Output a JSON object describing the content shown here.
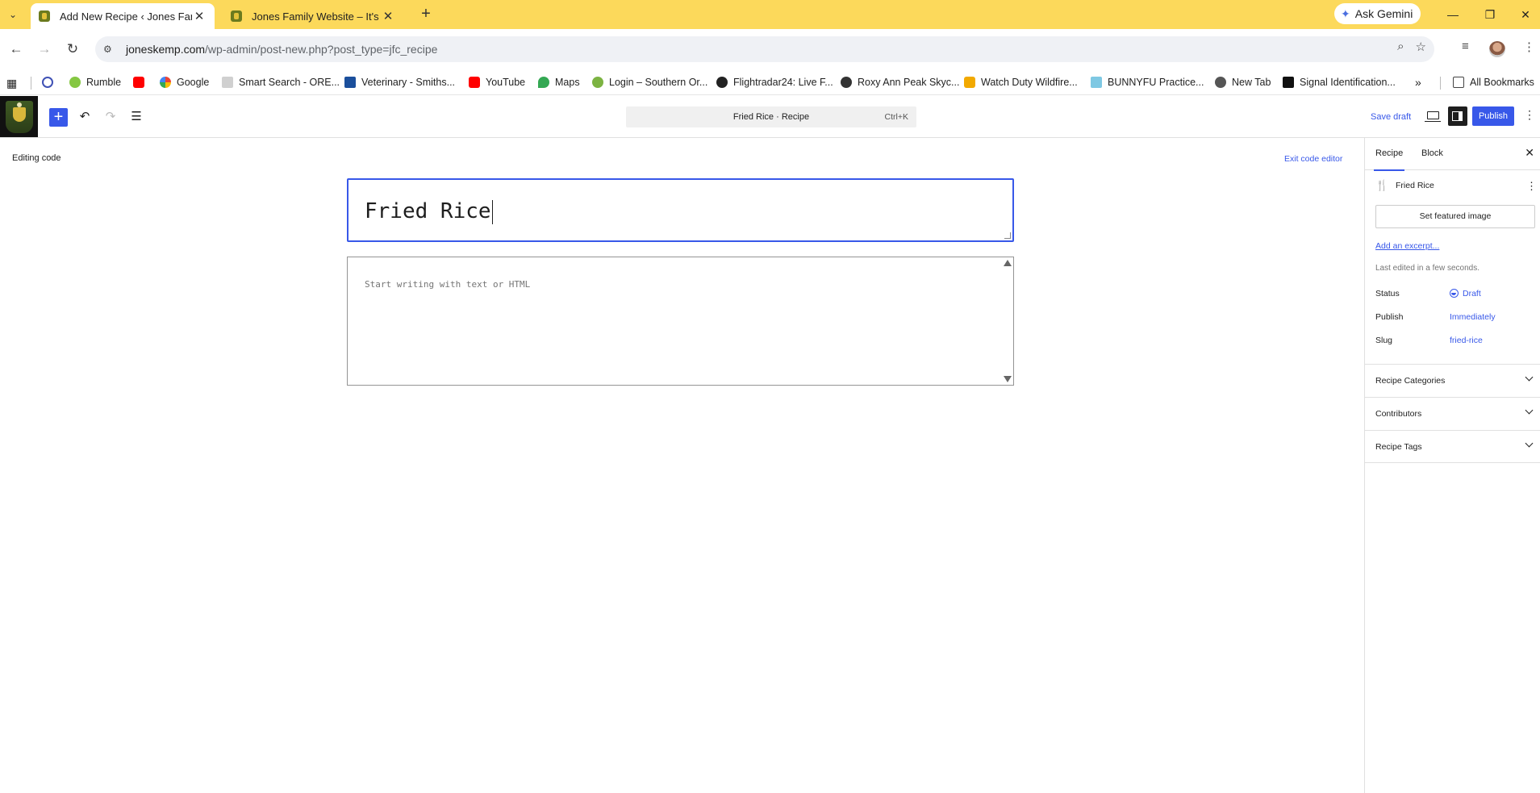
{
  "browser": {
    "tabs": [
      {
        "title": "Add New Recipe ‹ Jones Family",
        "active": true
      },
      {
        "title": "Jones Family Website – It's a Jo",
        "active": false
      }
    ],
    "ask_gemini": "Ask Gemini",
    "url_host": "joneskemp.com",
    "url_path": "/wp-admin/post-new.php?post_type=jfc_recipe",
    "bookmarks": [
      {
        "label": "Rumble",
        "color": "#85c742"
      },
      {
        "label": "",
        "color": "#ff0000"
      },
      {
        "label": "Google",
        "color": "#4285f4"
      },
      {
        "label": "Smart Search - ORE...",
        "color": "#9a9a9a"
      },
      {
        "label": "Veterinary - Smiths...",
        "color": "#1b4f9c"
      },
      {
        "label": "YouTube",
        "color": "#ff0000"
      },
      {
        "label": "Maps",
        "color": "#34a853"
      },
      {
        "label": "Login – Southern Or...",
        "color": "#7cb342"
      },
      {
        "label": "Flightradar24: Live F...",
        "color": "#222222"
      },
      {
        "label": "Roxy Ann Peak Skyc...",
        "color": "#333333"
      },
      {
        "label": "Watch Duty Wildfire...",
        "color": "#f2a900"
      },
      {
        "label": "BUNNYFU Practice...",
        "color": "#7ec8e3"
      },
      {
        "label": "New Tab",
        "color": "#555555"
      },
      {
        "label": "Signal Identification...",
        "color": "#111111"
      }
    ],
    "all_bookmarks": "All Bookmarks"
  },
  "editor": {
    "doc_title": "Fried Rice · Recipe",
    "shortcut": "Ctrl+K",
    "save_draft": "Save draft",
    "publish": "Publish",
    "editing_code": "Editing code",
    "exit_code_editor": "Exit code editor",
    "post_title": "Fried Rice",
    "content_placeholder": "Start writing with text or HTML"
  },
  "sidebar": {
    "tab_recipe": "Recipe",
    "tab_block": "Block",
    "post_name": "Fried Rice",
    "featured_image": "Set featured image",
    "add_excerpt": "Add an excerpt...",
    "last_edited": "Last edited in a few seconds.",
    "status_label": "Status",
    "status_value": "Draft",
    "publish_label": "Publish",
    "publish_value": "Immediately",
    "slug_label": "Slug",
    "slug_value": "fried-rice",
    "panels": [
      "Recipe Categories",
      "Contributors",
      "Recipe Tags"
    ]
  },
  "colors": {
    "accent": "#3858e9",
    "chrome_tabbar": "#fcd95b"
  }
}
